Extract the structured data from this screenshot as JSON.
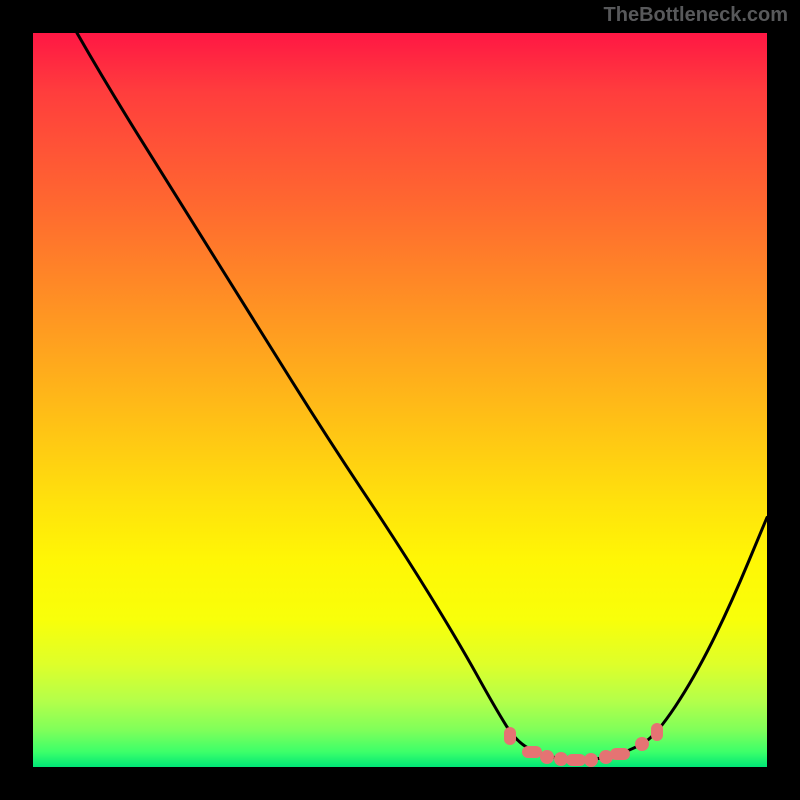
{
  "attribution": "TheBottleneck.com",
  "colors": {
    "frame": "#000000",
    "curve_stroke": "#000000",
    "dot_fill": "#e57373",
    "gradient_top": "#ff1744",
    "gradient_bottom": "#00e676"
  },
  "chart_data": {
    "type": "line",
    "title": "",
    "xlabel": "",
    "ylabel": "",
    "xlim": [
      0,
      100
    ],
    "ylim": [
      0,
      100
    ],
    "curve": [
      {
        "x": 6,
        "y": 100
      },
      {
        "x": 10,
        "y": 93
      },
      {
        "x": 20,
        "y": 77
      },
      {
        "x": 30,
        "y": 61
      },
      {
        "x": 40,
        "y": 45
      },
      {
        "x": 50,
        "y": 30
      },
      {
        "x": 58,
        "y": 17
      },
      {
        "x": 63,
        "y": 8
      },
      {
        "x": 66,
        "y": 3.2
      },
      {
        "x": 70,
        "y": 1.4
      },
      {
        "x": 74,
        "y": 0.9
      },
      {
        "x": 78,
        "y": 1.2
      },
      {
        "x": 82,
        "y": 2.5
      },
      {
        "x": 85,
        "y": 4.5
      },
      {
        "x": 90,
        "y": 12
      },
      {
        "x": 95,
        "y": 22
      },
      {
        "x": 100,
        "y": 34
      }
    ],
    "highlight_points": [
      {
        "x": 65,
        "y": 4.2
      },
      {
        "x": 68,
        "y": 2.0
      },
      {
        "x": 70,
        "y": 1.4
      },
      {
        "x": 72,
        "y": 1.1
      },
      {
        "x": 74,
        "y": 0.95
      },
      {
        "x": 76,
        "y": 1.0
      },
      {
        "x": 78,
        "y": 1.3
      },
      {
        "x": 80,
        "y": 1.8
      },
      {
        "x": 83,
        "y": 3.2
      },
      {
        "x": 85,
        "y": 4.8
      }
    ]
  }
}
